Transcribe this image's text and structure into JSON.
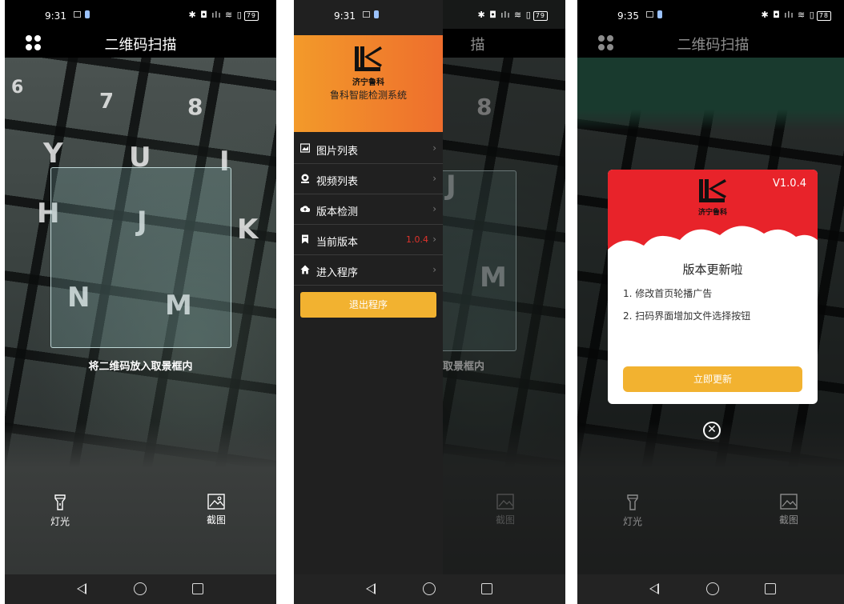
{
  "statusbar": [
    {
      "time": "9:31",
      "icons": "✱ ◘ ılı ≋ ▯",
      "battery": "79"
    },
    {
      "time": "9:31",
      "icons": "✱ ◘ ılı ≋ ▯",
      "battery": "79"
    },
    {
      "time": "9:35",
      "icons": "✱ ◘ ılı ≋ ▯",
      "battery": "78"
    }
  ],
  "appbar": {
    "title": "二维码扫描"
  },
  "scan": {
    "hint": "将二维码放入取景框内",
    "partial_hint": "取景框内",
    "partial_title": "描"
  },
  "tools": {
    "light_label": "灯光",
    "crop_label": "截图"
  },
  "drawer": {
    "company": "济宁鲁科",
    "system": "鲁科智能检测系统",
    "items": [
      {
        "label": "图片列表",
        "icon": "image-icon"
      },
      {
        "label": "视频列表",
        "icon": "video-icon"
      },
      {
        "label": "版本检测",
        "icon": "cloud-upload-icon"
      },
      {
        "label": "当前版本",
        "icon": "bookmark-icon",
        "value": "1.0.4"
      },
      {
        "label": "进入程序",
        "icon": "home-icon"
      }
    ],
    "exit_label": "退出程序"
  },
  "dialog": {
    "version": "V1.0.4",
    "company": "济宁鲁科",
    "title": "版本更新啦",
    "notes": [
      "1. 修改首页轮播广告",
      "2. 扫码界面增加文件选择按钮"
    ],
    "update_label": "立即更新",
    "close_glyph": "✕"
  },
  "keys": [
    "6",
    "7",
    "8",
    "Y",
    "U",
    "I",
    "H",
    "J",
    "K",
    "N",
    "M"
  ],
  "colors": {
    "accent": "#f2b230",
    "drawer_head": "#ee6e2d",
    "dialog_head": "#e8232a",
    "version_red": "#e0332c"
  }
}
